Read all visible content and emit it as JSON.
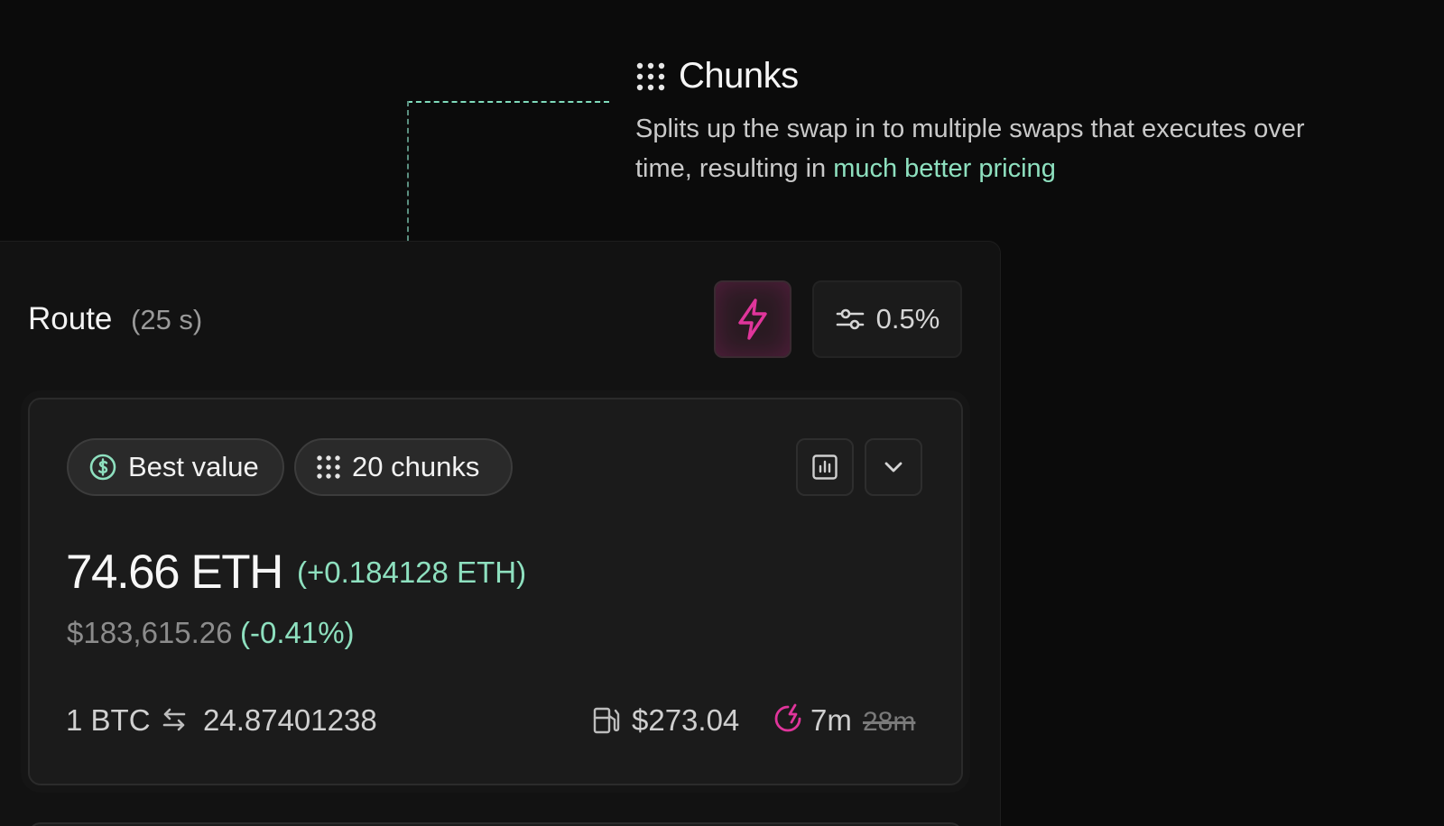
{
  "callout": {
    "title": "Chunks",
    "description": "Splits up the swap in to multiple swaps that executes over time, resulting in ",
    "description_accent": "much better pricing",
    "icon": "dots-grid-icon",
    "accent_color": "#8ee0bf"
  },
  "route": {
    "title": "Route",
    "timer": "(25 s)",
    "boost_icon": "lightning-bolt-icon",
    "boost_color": "#e0359b",
    "slippage_icon": "sliders-icon",
    "slippage": "0.5%"
  },
  "quote": {
    "badges": [
      {
        "icon": "dollar-circle-icon",
        "label": "Best value"
      },
      {
        "icon": "dots-grid-icon",
        "label": "20 chunks"
      }
    ],
    "chart_icon": "bar-chart-icon",
    "expand_icon": "chevron-down-icon",
    "amount": "74.66 ETH",
    "amount_delta": "(+0.184128 ETH)",
    "usd_value": "$183,615.26",
    "usd_change": "(-0.41%)",
    "rate_from": "1 BTC",
    "rate_icon": "swap-arrows-icon",
    "rate_to": "24.87401238",
    "gas_icon": "gas-pump-icon",
    "gas_fee": "$273.04",
    "time_icon": "fast-timer-icon",
    "time_new": "7m",
    "time_old": "28m"
  }
}
